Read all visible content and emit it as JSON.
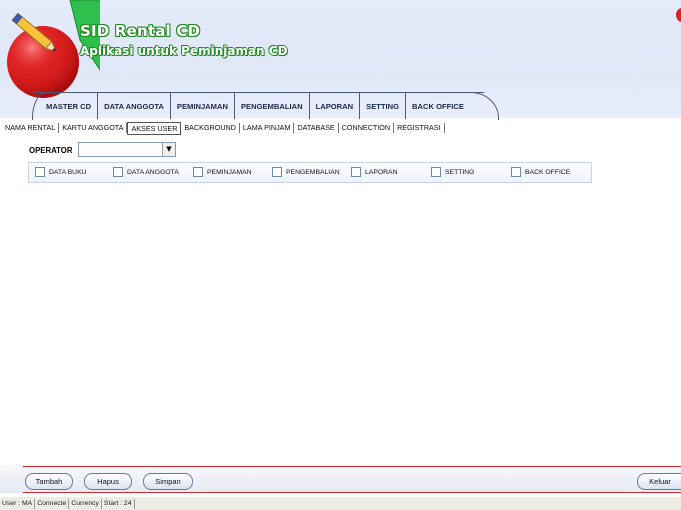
{
  "header": {
    "title": "SID Rental CD",
    "subtitle": "Aplikasi untuk Peminjaman CD"
  },
  "main_menu": [
    {
      "label": "MASTER CD"
    },
    {
      "label": "DATA ANGGOTA"
    },
    {
      "label": "PEMINJAMAN"
    },
    {
      "label": "PENGEMBALIAN"
    },
    {
      "label": "LAPORAN"
    },
    {
      "label": "SETTING"
    },
    {
      "label": "BACK OFFICE"
    }
  ],
  "sub_tabs": [
    {
      "label": "NAMA RENTAL"
    },
    {
      "label": "KARTU ANGGOTA"
    },
    {
      "label": "AKSES USER",
      "active": true
    },
    {
      "label": "BACKGROUND"
    },
    {
      "label": "LAMA PINJAM"
    },
    {
      "label": "DATABASE"
    },
    {
      "label": "CONNECTION"
    },
    {
      "label": "REGISTRASI"
    }
  ],
  "operator": {
    "label": "OPERATOR",
    "value": ""
  },
  "permissions": [
    {
      "label": "DATA BUKU",
      "checked": false
    },
    {
      "label": "DATA ANGGOTA",
      "checked": false
    },
    {
      "label": "PEMINJAMAN",
      "checked": false
    },
    {
      "label": "PENGEMBALIAN",
      "checked": false
    },
    {
      "label": "LAPORAN",
      "checked": false
    },
    {
      "label": "SETTING",
      "checked": false
    },
    {
      "label": "BACK OFFICE",
      "checked": false
    }
  ],
  "buttons": {
    "tambah": "Tambah",
    "hapus": "Hapus",
    "simpan": "Simpan",
    "keluar": "Keluar"
  },
  "status_bar": [
    "User : MA",
    "Connecte",
    "Currency",
    "Start : 24"
  ],
  "icons": {
    "logo": "red-ball-pencil-icon",
    "combo": "dropdown-arrow-icon",
    "corner": "red-ball-icon"
  },
  "colors": {
    "header_bg": "#e1e8f8",
    "title_outline": "#1f8a1f",
    "accent_red": "#cc2b2b",
    "logo_green": "#29b34a"
  }
}
